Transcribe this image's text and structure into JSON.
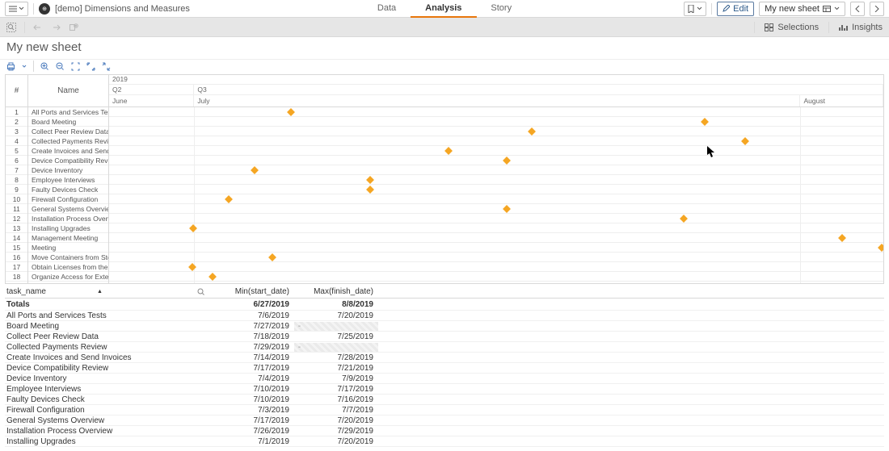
{
  "app_name": "[demo] Dimensions and Measures",
  "top_tabs": {
    "data": "Data",
    "analysis": "Analysis",
    "story": "Story"
  },
  "edit_label": "Edit",
  "sheet_name": "My new sheet",
  "selections_label": "Selections",
  "insights_label": "Insights",
  "name_hash": "#",
  "name_label": "Name",
  "timeline": {
    "year": "2019",
    "q2": "Q2",
    "q3": "Q3",
    "june": "June",
    "july": "July",
    "august": "August"
  },
  "gantt_rows": [
    {
      "n": "1",
      "name": "All Ports and Services Tests",
      "pos": 23.5
    },
    {
      "n": "2",
      "name": "Board Meeting",
      "pos": 76.9
    },
    {
      "n": "3",
      "name": "Collect Peer Review Data",
      "pos": 54.6
    },
    {
      "n": "4",
      "name": "Collected Payments Review",
      "pos": 82.1
    },
    {
      "n": "5",
      "name": "Create Invoices and Send Invoices",
      "pos": 43.8
    },
    {
      "n": "6",
      "name": "Device Compatibility Review",
      "pos": 51.4
    },
    {
      "n": "7",
      "name": "Device Inventory",
      "pos": 18.8
    },
    {
      "n": "8",
      "name": "Employee Interviews",
      "pos": 33.7
    },
    {
      "n": "9",
      "name": "Faulty Devices Check",
      "pos": 33.7
    },
    {
      "n": "10",
      "name": "Firewall Configuration",
      "pos": 15.5
    },
    {
      "n": "11",
      "name": "General Systems Overview",
      "pos": 51.4
    },
    {
      "n": "12",
      "name": "Installation Process Overview",
      "pos": 74.2
    },
    {
      "n": "13",
      "name": "Installing Upgrades",
      "pos": 10.9
    },
    {
      "n": "14",
      "name": "Management Meeting",
      "pos": 94.7
    },
    {
      "n": "15",
      "name": "Meeting",
      "pos": 99.8
    },
    {
      "n": "16",
      "name": "Move Containers from Storage Facility",
      "pos": 21.1
    },
    {
      "n": "17",
      "name": "Obtain Licenses from the Vendor",
      "pos": 10.7
    },
    {
      "n": "18",
      "name": "Organize Access for External Audit Team",
      "pos": 13.4
    }
  ],
  "table": {
    "col1": "task_name",
    "col2": "Min(start_date)",
    "col3": "Max(finish_date)",
    "totals_label": "Totals",
    "totals_min": "6/27/2019",
    "totals_max": "8/8/2019",
    "rows": [
      {
        "name": "All Ports and Services Tests",
        "min": "7/6/2019",
        "max": "7/20/2019"
      },
      {
        "name": "Board Meeting",
        "min": "7/27/2019",
        "max": null
      },
      {
        "name": "Collect Peer Review Data",
        "min": "7/18/2019",
        "max": "7/25/2019"
      },
      {
        "name": "Collected Payments Review",
        "min": "7/29/2019",
        "max": null
      },
      {
        "name": "Create Invoices and Send Invoices",
        "min": "7/14/2019",
        "max": "7/28/2019"
      },
      {
        "name": "Device Compatibility Review",
        "min": "7/17/2019",
        "max": "7/21/2019"
      },
      {
        "name": "Device Inventory",
        "min": "7/4/2019",
        "max": "7/9/2019"
      },
      {
        "name": "Employee Interviews",
        "min": "7/10/2019",
        "max": "7/17/2019"
      },
      {
        "name": "Faulty Devices Check",
        "min": "7/10/2019",
        "max": "7/16/2019"
      },
      {
        "name": "Firewall Configuration",
        "min": "7/3/2019",
        "max": "7/7/2019"
      },
      {
        "name": "General Systems Overview",
        "min": "7/17/2019",
        "max": "7/20/2019"
      },
      {
        "name": "Installation Process Overview",
        "min": "7/26/2019",
        "max": "7/29/2019"
      },
      {
        "name": "Installing Upgrades",
        "min": "7/1/2019",
        "max": "7/20/2019"
      }
    ]
  }
}
